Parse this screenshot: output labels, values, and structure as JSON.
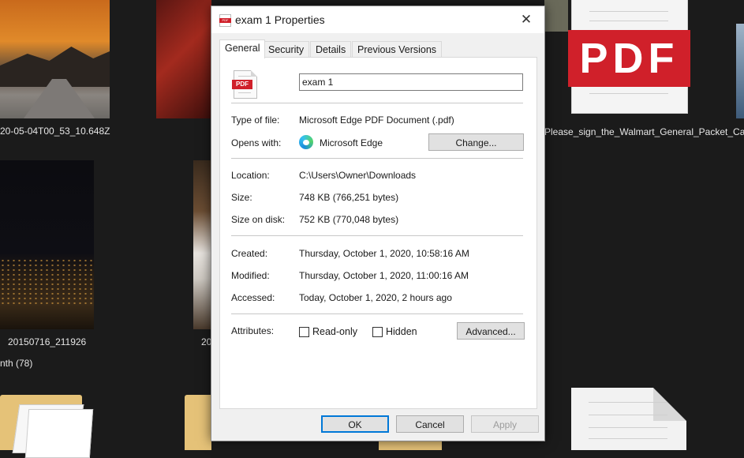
{
  "background": {
    "labels": {
      "item1": "20-05-04T00_53_10.648Z",
      "item2": "Please_sign_the_Walmart_General_Packet_Cara_",
      "item3": "20150716_211926",
      "item4": "20",
      "group": "nth (78)"
    },
    "pdf_badge": "PDF"
  },
  "dialog": {
    "title": "exam 1 Properties",
    "close_glyph": "✕",
    "tabs": [
      "General",
      "Security",
      "Details",
      "Previous Versions"
    ],
    "active_tab": "General",
    "file_icon_badge": "PDF",
    "file_name": "exam 1",
    "rows": {
      "type_label": "Type of file:",
      "type_value": "Microsoft Edge PDF Document (.pdf)",
      "opens_label": "Opens with:",
      "opens_value": "Microsoft Edge",
      "change_button": "Change...",
      "location_label": "Location:",
      "location_value": "C:\\Users\\Owner\\Downloads",
      "size_label": "Size:",
      "size_value": "748 KB (766,251 bytes)",
      "size_disk_label": "Size on disk:",
      "size_disk_value": "752 KB (770,048 bytes)",
      "created_label": "Created:",
      "created_value": "Thursday, October 1, 2020, 10:58:16 AM",
      "modified_label": "Modified:",
      "modified_value": "Thursday, October 1, 2020, 11:00:16 AM",
      "accessed_label": "Accessed:",
      "accessed_value": "Today, October 1, 2020, 2 hours ago",
      "attributes_label": "Attributes:",
      "readonly_label": "Read-only",
      "hidden_label": "Hidden",
      "advanced_button": "Advanced..."
    },
    "buttons": {
      "ok": "OK",
      "cancel": "Cancel",
      "apply": "Apply"
    },
    "colors": {
      "accent": "#0078d7",
      "pdf_red": "#d0202a"
    }
  }
}
